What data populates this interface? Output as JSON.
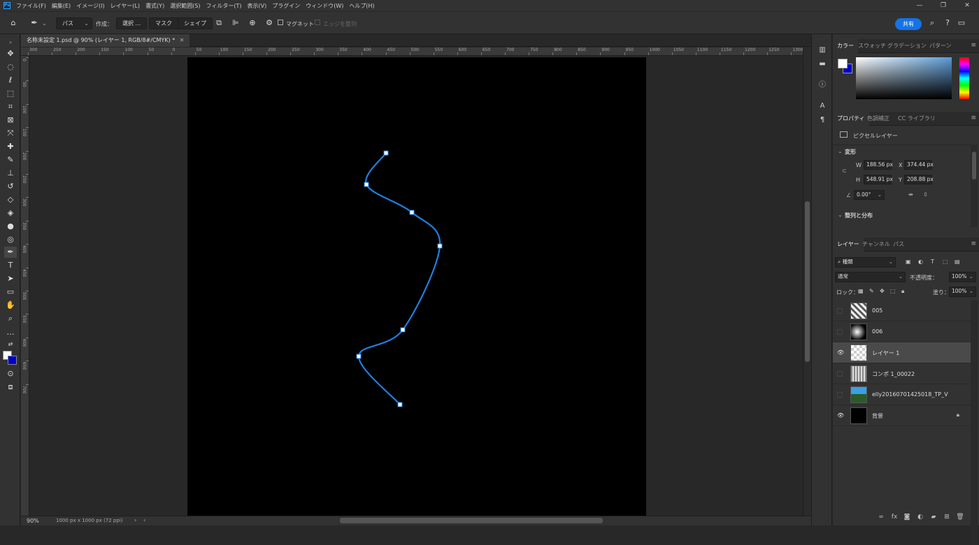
{
  "app": {
    "logo": "Ps"
  },
  "menu": [
    "ファイル(F)",
    "編集(E)",
    "イメージ(I)",
    "レイヤー(L)",
    "書式(Y)",
    "選択範囲(S)",
    "フィルター(T)",
    "表示(V)",
    "プラグイン",
    "ウィンドウ(W)",
    "ヘルプ(H)"
  ],
  "window_controls": [
    "—",
    "❐",
    "✕"
  ],
  "options": {
    "mode": "パス",
    "make_label": "作成：",
    "select_btn": "選択 ...",
    "mask_btn": "マスク",
    "shape_btn": "シェイプ",
    "magnet_label": "マグネット",
    "edge_align_label": "エッジを整列",
    "share": "共有"
  },
  "document": {
    "tab_title": "名称未設定 1.psd @ 90% (レイヤー 1, RGB/8#/CMYK) *",
    "zoom": "90%",
    "size_info": "1000 px x 1000 px (72 ppi)"
  },
  "ruler": {
    "h_labels": [
      "300",
      "250",
      "200",
      "150",
      "100",
      "50",
      "0",
      "50",
      "100",
      "150",
      "200",
      "250",
      "300",
      "350",
      "400",
      "450",
      "500",
      "550",
      "600",
      "650",
      "700",
      "750",
      "800",
      "850",
      "900",
      "950",
      "1000",
      "1050",
      "1100",
      "1150",
      "1200",
      "1250",
      "1300"
    ],
    "v_labels": [
      "0",
      "50",
      "100",
      "150",
      "200",
      "250",
      "300",
      "350",
      "400",
      "450",
      "500",
      "550",
      "600",
      "650",
      "700"
    ]
  },
  "path": {
    "color": "#1e7fe0",
    "anchors": [
      [
        552,
        219
      ],
      [
        524,
        264
      ],
      [
        589,
        304
      ],
      [
        629,
        352
      ],
      [
        576,
        472
      ],
      [
        513,
        510
      ],
      [
        572,
        579
      ]
    ]
  },
  "color_panel": {
    "tabs": [
      "カラー",
      "スウォッチ",
      "グラデーション",
      "パターン"
    ],
    "fg_color": "#ffffff",
    "bg_color": "#0000cc"
  },
  "properties": {
    "tabs": [
      "プロパティ",
      "色調補正",
      "CC ライブラリ"
    ],
    "layer_type": "ピクセルレイヤー",
    "transform_label": "変形",
    "w_label": "W",
    "w": "188.56 px",
    "x_label": "X",
    "x": "374.44 px",
    "h_label": "H",
    "h": "548.91 px",
    "y_label": "Y",
    "y": "208.88 px",
    "angle": "0.00°",
    "align_label": "整列と分布"
  },
  "layers_panel": {
    "tabs": [
      "レイヤー",
      "チャンネル",
      "パス"
    ],
    "filter": "種類",
    "blend": "通常",
    "opacity_label": "不透明度：",
    "opacity": "100%",
    "lock_label": "ロック：",
    "fill_label": "塗り：",
    "fill": "100%",
    "layers": [
      {
        "name": "005",
        "visible": false,
        "selected": false
      },
      {
        "name": "006",
        "visible": false,
        "selected": false
      },
      {
        "name": "レイヤー 1",
        "visible": true,
        "selected": true
      },
      {
        "name": "コンポ 1_00022",
        "visible": false,
        "selected": false
      },
      {
        "name": "elly20160701425018_TP_V",
        "visible": false,
        "selected": false
      },
      {
        "name": "背景",
        "visible": true,
        "selected": false,
        "locked": true
      }
    ]
  }
}
